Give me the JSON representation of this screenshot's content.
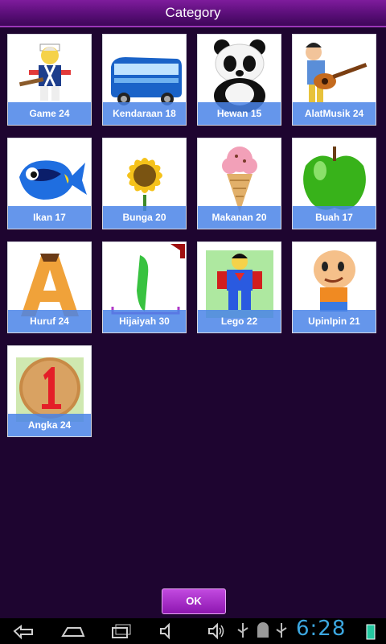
{
  "header": {
    "title": "Category"
  },
  "categories": [
    {
      "label": "Game 24",
      "icon": "lego-soldier-icon"
    },
    {
      "label": "Kendaraan 18",
      "icon": "bus-icon"
    },
    {
      "label": "Hewan 15",
      "icon": "panda-icon"
    },
    {
      "label": "AlatMusik 24",
      "icon": "guitar-player-icon"
    },
    {
      "label": "Ikan 17",
      "icon": "fish-icon"
    },
    {
      "label": "Bunga 20",
      "icon": "sunflower-icon"
    },
    {
      "label": "Makanan 20",
      "icon": "ice-cream-icon"
    },
    {
      "label": "Buah 17",
      "icon": "apple-icon"
    },
    {
      "label": "Huruf 24",
      "icon": "letter-a-icon"
    },
    {
      "label": "Hijaiyah 30",
      "icon": "arabic-alif-icon"
    },
    {
      "label": "Lego 22",
      "icon": "lego-superman-icon"
    },
    {
      "label": "UpinIpin 21",
      "icon": "upin-ipin-icon"
    },
    {
      "label": "Angka 24",
      "icon": "number-one-icon"
    }
  ],
  "footer": {
    "ok_label": "OK"
  },
  "system_bar": {
    "time": "6:28"
  },
  "colors": {
    "background": "#1e0530",
    "title_bar": "#6a1288",
    "label_band": "#4a84e8",
    "ok_button": "#a52dcc",
    "clock": "#3ca7e0"
  }
}
